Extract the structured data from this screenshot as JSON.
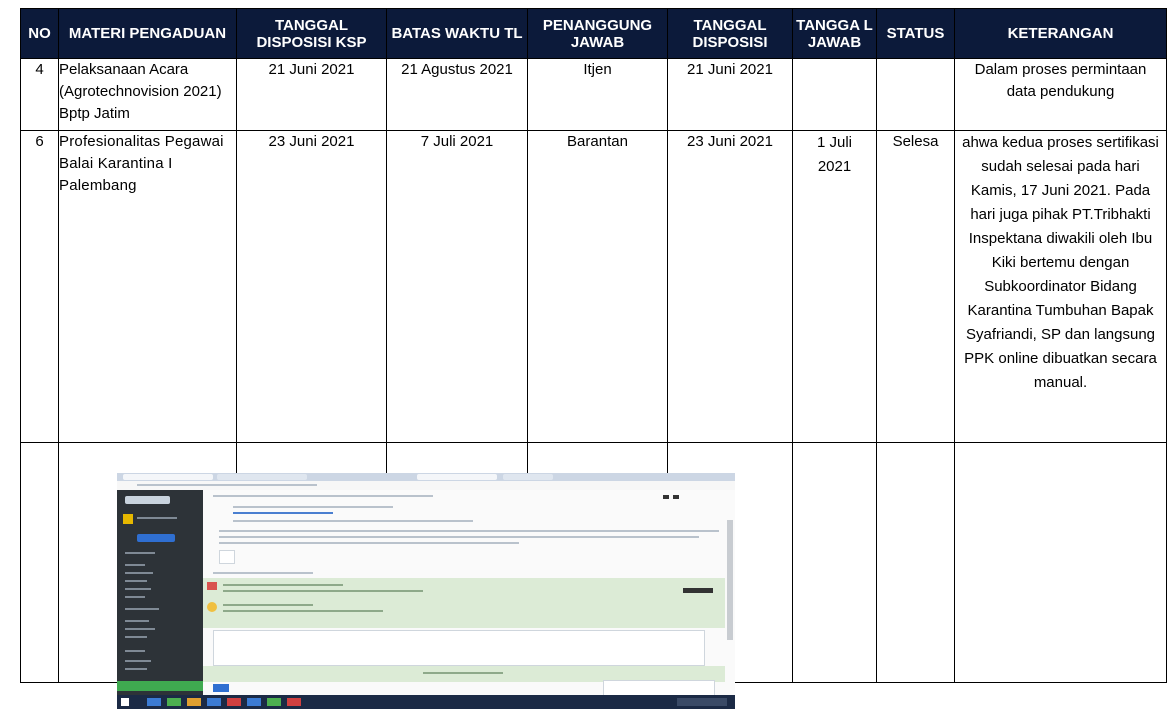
{
  "headers": [
    "NO",
    "MATERI PENGADUAN",
    "TANGGAL DISPOSISI KSP",
    "BATAS WAKTU TL",
    "PENANGGUNG JAWAB",
    "TANGGAL DISPOSISI",
    "TANGGA L JAWAB",
    "STATUS",
    "KETERANGAN"
  ],
  "rows": [
    {
      "no": "4",
      "materi": "Pelaksanaan Acara (Agrotechnovision 2021) Bptp Jatim",
      "tgl_ksp": "21 Juni 2021",
      "batas": "21 Agustus 2021",
      "pj": "Itjen",
      "tgl_disp": "21 Juni 2021",
      "tgl_jawab": "",
      "status": "",
      "ket": "Dalam proses permintaan data pendukung"
    },
    {
      "no": "6",
      "materi": "Profesionalitas Pegawai Balai Karantina I Palembang",
      "tgl_ksp": "23 Juni 2021",
      "batas": "7 Juli 2021",
      "pj": "Barantan",
      "tgl_disp": "23 Juni 2021",
      "tgl_jawab": "1 Juli 2021",
      "status": "Selesa",
      "ket": "ahwa kedua proses sertifikasi sudah selesai pada hari Kamis, 17 Juni 2021. Pada hari juga pihak PT.Tribhakti Inspektana diwakili oleh Ibu Kiki bertemu dengan Subkoordinator Bidang Karantina Tumbuhan Bapak Syafriandi, SP dan langsung PPK online dibuatkan secara manual."
    }
  ],
  "colors": {
    "header_bg": "#0c1a3a",
    "header_text": "#ffffff"
  }
}
